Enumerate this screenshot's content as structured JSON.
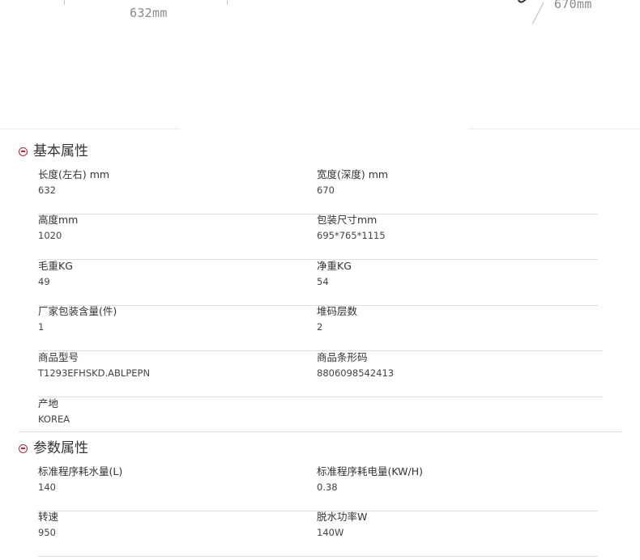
{
  "diagram": {
    "width_label": "632mm",
    "depth_label": "670mm"
  },
  "sections": [
    {
      "title": "基本属性",
      "rows": [
        {
          "left": {
            "label": "长度(左右) mm",
            "value": "632"
          },
          "right": {
            "label": "宽度(深度) mm",
            "value": "670"
          }
        },
        {
          "left": {
            "label": "高度mm",
            "value": "1020"
          },
          "right": {
            "label": "包装尺寸mm",
            "value": "695*765*1115"
          }
        },
        {
          "left": {
            "label": "毛重KG",
            "value": "49"
          },
          "right": {
            "label": "净重KG",
            "value": "54"
          }
        },
        {
          "left": {
            "label": "厂家包装含量(件)",
            "value": "1"
          },
          "right": {
            "label": "堆码层数",
            "value": "2"
          }
        },
        {
          "left": {
            "label": "商品型号",
            "value": "T1293EFHSKD.ABLPEPN"
          },
          "right": {
            "label": "商品条形码",
            "value": "8806098542413"
          }
        },
        {
          "left": {
            "label": "产地",
            "value": "KOREA"
          }
        }
      ]
    },
    {
      "title": "参数属性",
      "rows": [
        {
          "left": {
            "label": "标准程序耗水量(L)",
            "value": "140"
          },
          "right": {
            "label": "标准程序耗电量(KW/H)",
            "value": "0.38"
          }
        },
        {
          "left": {
            "label": "转速",
            "value": "950"
          },
          "right": {
            "label": "脱水功率W",
            "value": "140W"
          }
        }
      ]
    }
  ]
}
